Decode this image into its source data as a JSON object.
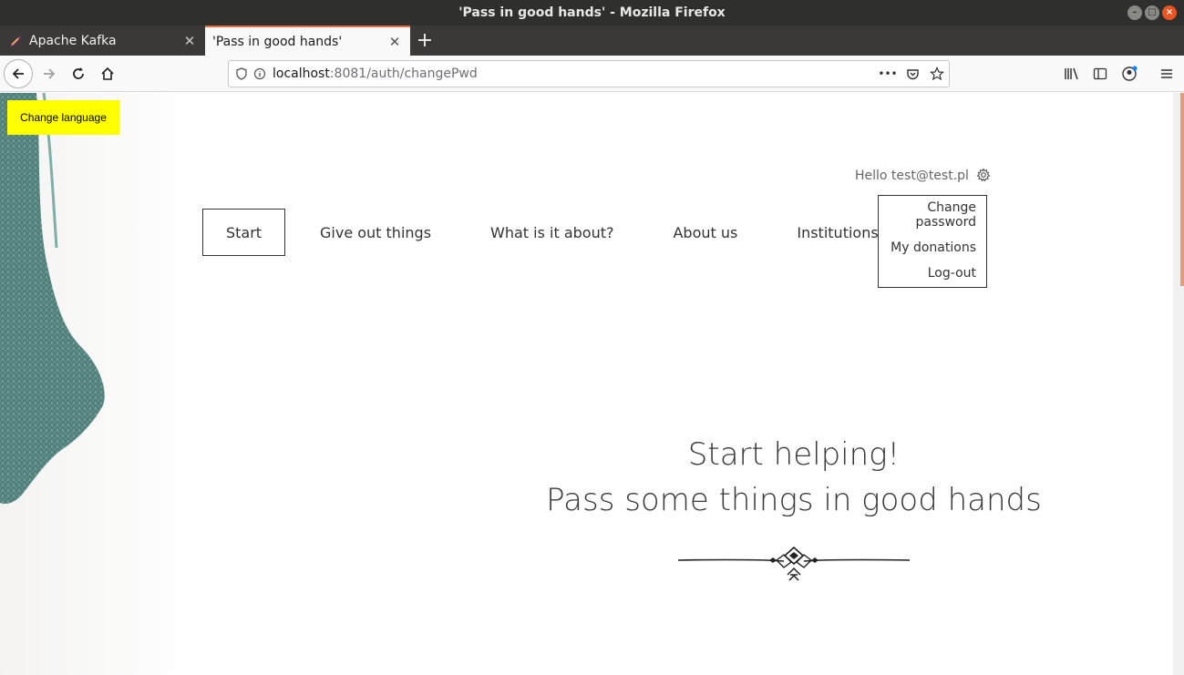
{
  "window": {
    "title": "'Pass in good hands' - Mozilla Firefox"
  },
  "tabs": [
    {
      "title": "Apache Kafka",
      "icon": "kafka-feather-icon",
      "active": false
    },
    {
      "title": "'Pass in good hands'",
      "icon": "none",
      "active": true
    }
  ],
  "toolbar": {
    "url_host": "localhost",
    "url_rest": ":8081/auth/changePwd",
    "overflow_label": "•••"
  },
  "page": {
    "change_language": "Change language",
    "hello": "Hello test@test.pl",
    "menu": [
      {
        "label": "Start",
        "active": true
      },
      {
        "label": "Give out things",
        "active": false
      },
      {
        "label": "What is it about?",
        "active": false
      },
      {
        "label": "About us",
        "active": false
      },
      {
        "label": "Institutions",
        "active": false
      }
    ],
    "user_menu": {
      "change_password_line1": "Change",
      "change_password_line2": "password",
      "my_donations": "My donations",
      "logout": "Log-out"
    },
    "hero": {
      "line1": "Start helping!",
      "line2": "Pass some things in good hands"
    }
  },
  "colors": {
    "accent": "#e66a3b",
    "language_button": "#ffff00",
    "text": "#333333",
    "scarf": "#5f8f8a"
  }
}
